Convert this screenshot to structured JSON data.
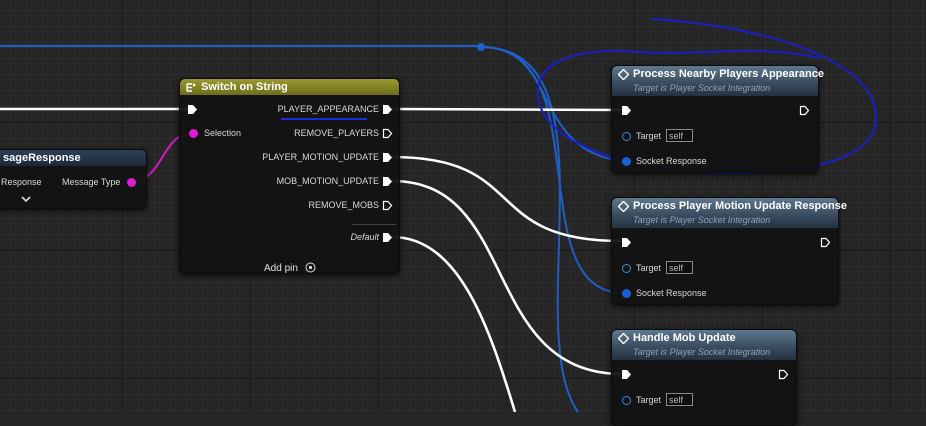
{
  "colors": {
    "background": "#262626",
    "exec_wire": "#ffffff",
    "object_wire": "#1f5fc8",
    "string_wire": "#d11cc7",
    "annotation": "#1a1fc8",
    "function_header": "#3b4d60",
    "switch_header": "#8a8a2a"
  },
  "left_node": {
    "title": "sageResponse",
    "pin_left_label": "Response",
    "pin_right_label": "Message Type",
    "icon": "chevron-down-icon"
  },
  "switch_node": {
    "title": "Switch on String",
    "icon": "switch-icon",
    "input_selection": "Selection",
    "outputs": [
      "PLAYER_APPEARANCE",
      "REMOVE_PLAYERS",
      "PLAYER_MOTION_UPDATE",
      "MOB_MOTION_UPDATE",
      "REMOVE_MOBS"
    ],
    "default_label": "Default",
    "add_pin_label": "Add pin",
    "add_pin_icon": "plus-circle-icon"
  },
  "function_nodes": [
    {
      "title": "Process Nearby Players Appearance",
      "subtitle": "Target is Player Socket Integration",
      "target_label": "Target",
      "target_value": "self",
      "socket_label": "Socket Response"
    },
    {
      "title": "Process Player Motion Update Response",
      "subtitle": "Target is Player Socket Integration",
      "target_label": "Target",
      "target_value": "self",
      "socket_label": "Socket Response"
    },
    {
      "title": "Handle Mob Update",
      "subtitle": "Target is Player Socket Integration",
      "target_label": "Target",
      "target_value": "self"
    }
  ]
}
